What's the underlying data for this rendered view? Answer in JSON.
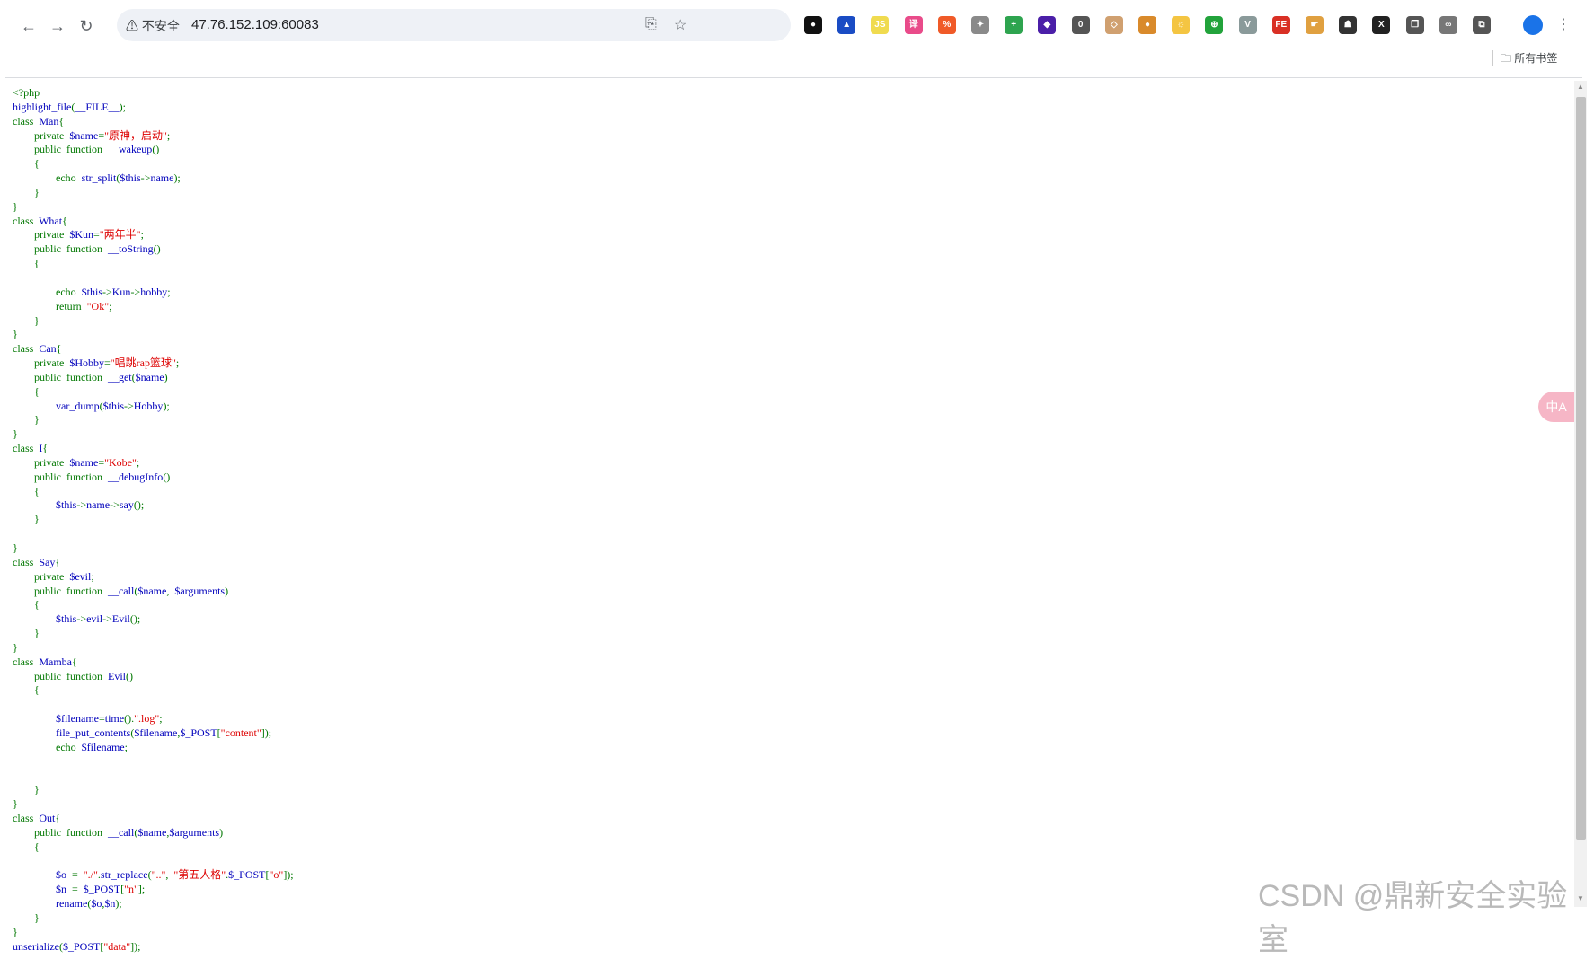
{
  "browser": {
    "security_label": "不安全",
    "url": "47.76.152.109:60083",
    "bookmarks_label": "所有书签",
    "floating_translate_label": "中A"
  },
  "extensions": [
    {
      "icon": "circle-icon",
      "color": "#111111",
      "text": "●"
    },
    {
      "icon": "triangle-icon",
      "color": "#1a4cc4",
      "text": "▲"
    },
    {
      "icon": "js-icon",
      "color": "#f0db4f",
      "text": "JS"
    },
    {
      "icon": "translate-icon",
      "color": "#e94b8a",
      "text": "译"
    },
    {
      "icon": "percent-icon",
      "color": "#f05a28",
      "text": "%"
    },
    {
      "icon": "puzzle-icon",
      "color": "#8a8a8a",
      "text": "✦"
    },
    {
      "icon": "plus-icon",
      "color": "#2ea44f",
      "text": "+"
    },
    {
      "icon": "diamond-icon",
      "color": "#4b1fa8",
      "text": "◆"
    },
    {
      "icon": "counter-icon",
      "color": "#555555",
      "text": "0"
    },
    {
      "icon": "target-icon",
      "color": "#d0a070",
      "text": "◇"
    },
    {
      "icon": "cookie-icon",
      "color": "#d98a2b",
      "text": "●"
    },
    {
      "icon": "sun-icon",
      "color": "#f4c542",
      "text": "☼"
    },
    {
      "icon": "globe-icon",
      "color": "#22a33b",
      "text": "⊕"
    },
    {
      "icon": "vue-icon",
      "color": "#8a9a9a",
      "text": "V"
    },
    {
      "icon": "fe-icon",
      "color": "#d93025",
      "text": "FE"
    },
    {
      "icon": "hand-icon",
      "color": "#e0a040",
      "text": "☛"
    },
    {
      "icon": "hat-icon",
      "color": "#333333",
      "text": "☗"
    },
    {
      "icon": "x-icon",
      "color": "#222222",
      "text": "X"
    },
    {
      "icon": "copy-icon",
      "color": "#555555",
      "text": "❐"
    },
    {
      "icon": "link-icon",
      "color": "#777777",
      "text": "∞"
    },
    {
      "icon": "extensions-icon",
      "color": "#555555",
      "text": "⧉"
    }
  ],
  "code_lines": [
    [
      [
        "kw",
        "<?php"
      ]
    ],
    [
      [
        "",
        "highlight_file"
      ],
      [
        "kw",
        "("
      ],
      [
        "",
        "__FILE__"
      ],
      [
        "kw",
        ");"
      ]
    ],
    [
      [
        "kw",
        "class  "
      ],
      [
        "",
        "Man"
      ],
      [
        "kw",
        "{"
      ]
    ],
    [
      [
        "kw",
        "        private  "
      ],
      [
        "",
        "$name"
      ],
      [
        "kw",
        "="
      ],
      [
        "str",
        "\"原神，启动\""
      ],
      [
        "kw",
        ";"
      ]
    ],
    [
      [
        "kw",
        "        public  function  "
      ],
      [
        "",
        "__wakeup"
      ],
      [
        "kw",
        "()"
      ]
    ],
    [
      [
        "kw",
        "        {"
      ]
    ],
    [
      [
        "kw",
        "                echo  "
      ],
      [
        "",
        "str_split"
      ],
      [
        "kw",
        "("
      ],
      [
        "",
        "$this"
      ],
      [
        "kw",
        "->"
      ],
      [
        "",
        "name"
      ],
      [
        "kw",
        ");"
      ]
    ],
    [
      [
        "kw",
        "        }"
      ]
    ],
    [
      [
        "kw",
        "}"
      ]
    ],
    [
      [
        "kw",
        "class  "
      ],
      [
        "",
        "What"
      ],
      [
        "kw",
        "{"
      ]
    ],
    [
      [
        "kw",
        "        private  "
      ],
      [
        "",
        "$Kun"
      ],
      [
        "kw",
        "="
      ],
      [
        "str",
        "\"两年半\""
      ],
      [
        "kw",
        ";"
      ]
    ],
    [
      [
        "kw",
        "        public  function  "
      ],
      [
        "",
        "__toString"
      ],
      [
        "kw",
        "()"
      ]
    ],
    [
      [
        "kw",
        "        {"
      ]
    ],
    [
      [
        "",
        ""
      ]
    ],
    [
      [
        "kw",
        "                echo  "
      ],
      [
        "",
        "$this"
      ],
      [
        "kw",
        "->"
      ],
      [
        "",
        "Kun"
      ],
      [
        "kw",
        "->"
      ],
      [
        "",
        "hobby"
      ],
      [
        "kw",
        ";"
      ]
    ],
    [
      [
        "kw",
        "                return  "
      ],
      [
        "str",
        "\"Ok\""
      ],
      [
        "kw",
        ";"
      ]
    ],
    [
      [
        "kw",
        "        }"
      ]
    ],
    [
      [
        "kw",
        "}"
      ]
    ],
    [
      [
        "kw",
        "class  "
      ],
      [
        "",
        "Can"
      ],
      [
        "kw",
        "{"
      ]
    ],
    [
      [
        "kw",
        "        private  "
      ],
      [
        "",
        "$Hobby"
      ],
      [
        "kw",
        "="
      ],
      [
        "str",
        "\"唱跳rap篮球\""
      ],
      [
        "kw",
        ";"
      ]
    ],
    [
      [
        "kw",
        "        public  function  "
      ],
      [
        "",
        "__get"
      ],
      [
        "kw",
        "("
      ],
      [
        "",
        "$name"
      ],
      [
        "kw",
        ")"
      ]
    ],
    [
      [
        "kw",
        "        {"
      ]
    ],
    [
      [
        "",
        "                var_dump"
      ],
      [
        "kw",
        "("
      ],
      [
        "",
        "$this"
      ],
      [
        "kw",
        "->"
      ],
      [
        "",
        "Hobby"
      ],
      [
        "kw",
        ");"
      ]
    ],
    [
      [
        "kw",
        "        }"
      ]
    ],
    [
      [
        "kw",
        "}"
      ]
    ],
    [
      [
        "kw",
        "class  "
      ],
      [
        "",
        "I"
      ],
      [
        "kw",
        "{"
      ]
    ],
    [
      [
        "kw",
        "        private  "
      ],
      [
        "",
        "$name"
      ],
      [
        "kw",
        "="
      ],
      [
        "str",
        "\"Kobe\""
      ],
      [
        "kw",
        ";"
      ]
    ],
    [
      [
        "kw",
        "        public  function  "
      ],
      [
        "",
        "__debugInfo"
      ],
      [
        "kw",
        "()"
      ]
    ],
    [
      [
        "kw",
        "        {"
      ]
    ],
    [
      [
        "",
        "                $this"
      ],
      [
        "kw",
        "->"
      ],
      [
        "",
        "name"
      ],
      [
        "kw",
        "->"
      ],
      [
        "",
        "say"
      ],
      [
        "kw",
        "();"
      ]
    ],
    [
      [
        "kw",
        "        }"
      ]
    ],
    [
      [
        "",
        ""
      ]
    ],
    [
      [
        "kw",
        "}"
      ]
    ],
    [
      [
        "kw",
        "class  "
      ],
      [
        "",
        "Say"
      ],
      [
        "kw",
        "{"
      ]
    ],
    [
      [
        "kw",
        "        private  "
      ],
      [
        "",
        "$evil"
      ],
      [
        "kw",
        ";"
      ]
    ],
    [
      [
        "kw",
        "        public  function  "
      ],
      [
        "",
        "__call"
      ],
      [
        "kw",
        "("
      ],
      [
        "",
        "$name"
      ],
      [
        "kw",
        ",  "
      ],
      [
        "",
        "$arguments"
      ],
      [
        "kw",
        ")"
      ]
    ],
    [
      [
        "kw",
        "        {"
      ]
    ],
    [
      [
        "",
        "                $this"
      ],
      [
        "kw",
        "->"
      ],
      [
        "",
        "evil"
      ],
      [
        "kw",
        "->"
      ],
      [
        "",
        "Evil"
      ],
      [
        "kw",
        "();"
      ]
    ],
    [
      [
        "kw",
        "        }"
      ]
    ],
    [
      [
        "kw",
        "}"
      ]
    ],
    [
      [
        "kw",
        "class  "
      ],
      [
        "",
        "Mamba"
      ],
      [
        "kw",
        "{"
      ]
    ],
    [
      [
        "kw",
        "        public  function  "
      ],
      [
        "",
        "Evil"
      ],
      [
        "kw",
        "()"
      ]
    ],
    [
      [
        "kw",
        "        {"
      ]
    ],
    [
      [
        "",
        ""
      ]
    ],
    [
      [
        "",
        "                $filename"
      ],
      [
        "kw",
        "="
      ],
      [
        "",
        "time"
      ],
      [
        "kw",
        "()."
      ],
      [
        "str",
        "\".log\""
      ],
      [
        "kw",
        ";"
      ]
    ],
    [
      [
        "",
        "                file_put_contents"
      ],
      [
        "kw",
        "("
      ],
      [
        "",
        "$filename"
      ],
      [
        "kw",
        ","
      ],
      [
        "",
        "$_POST"
      ],
      [
        "kw",
        "["
      ],
      [
        "str",
        "\"content\""
      ],
      [
        "kw",
        "]);"
      ]
    ],
    [
      [
        "kw",
        "                echo  "
      ],
      [
        "",
        "$filename"
      ],
      [
        "kw",
        ";"
      ]
    ],
    [
      [
        "",
        ""
      ]
    ],
    [
      [
        "",
        ""
      ]
    ],
    [
      [
        "kw",
        "        }"
      ]
    ],
    [
      [
        "kw",
        "}"
      ]
    ],
    [
      [
        "kw",
        "class  "
      ],
      [
        "",
        "Out"
      ],
      [
        "kw",
        "{"
      ]
    ],
    [
      [
        "kw",
        "        public  function  "
      ],
      [
        "",
        "__call"
      ],
      [
        "kw",
        "("
      ],
      [
        "",
        "$name"
      ],
      [
        "kw",
        ","
      ],
      [
        "",
        "$arguments"
      ],
      [
        "kw",
        ")"
      ]
    ],
    [
      [
        "kw",
        "        {"
      ]
    ],
    [
      [
        "",
        ""
      ]
    ],
    [
      [
        "",
        "                $o  "
      ],
      [
        "kw",
        "=  "
      ],
      [
        "str",
        "\"./\""
      ],
      [
        "kw",
        "."
      ],
      [
        "",
        "str_replace"
      ],
      [
        "kw",
        "("
      ],
      [
        "str",
        "\"..\""
      ],
      [
        "kw",
        ",  "
      ],
      [
        "str",
        "\"第五人格\""
      ],
      [
        "kw",
        "."
      ],
      [
        "",
        "$_POST"
      ],
      [
        "kw",
        "["
      ],
      [
        "str",
        "\"o\""
      ],
      [
        "kw",
        "]);"
      ]
    ],
    [
      [
        "",
        "                $n  "
      ],
      [
        "kw",
        "=  "
      ],
      [
        "",
        "$_POST"
      ],
      [
        "kw",
        "["
      ],
      [
        "str",
        "\"n\""
      ],
      [
        "kw",
        "];"
      ]
    ],
    [
      [
        "",
        "                rename"
      ],
      [
        "kw",
        "("
      ],
      [
        "",
        "$o"
      ],
      [
        "kw",
        ","
      ],
      [
        "",
        "$n"
      ],
      [
        "kw",
        ");"
      ]
    ],
    [
      [
        "kw",
        "        }"
      ]
    ],
    [
      [
        "kw",
        "}"
      ]
    ],
    [
      [
        "",
        "unserialize"
      ],
      [
        "kw",
        "("
      ],
      [
        "",
        "$_POST"
      ],
      [
        "kw",
        "["
      ],
      [
        "str",
        "\"data\""
      ],
      [
        "kw",
        "]);"
      ]
    ]
  ],
  "watermark": "CSDN @鼎新安全实验室"
}
